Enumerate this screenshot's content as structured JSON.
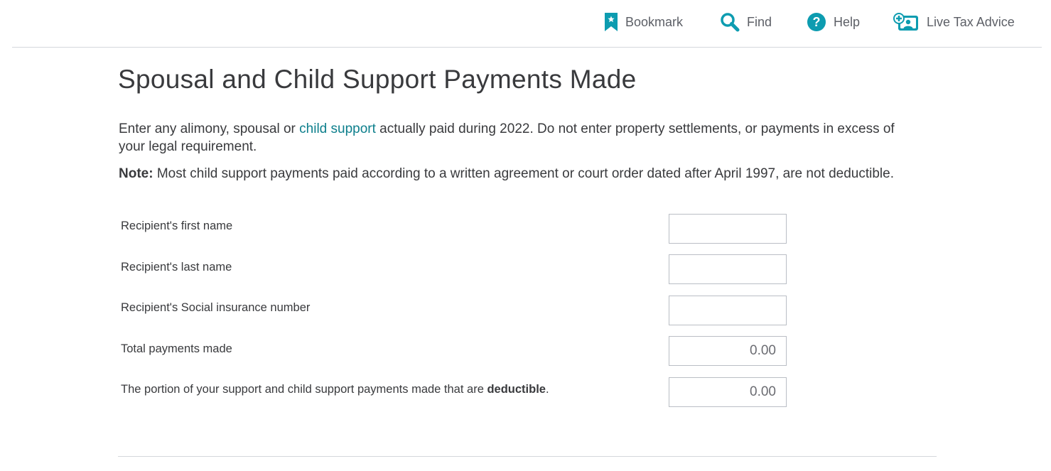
{
  "toolbar": {
    "bookmark_label": "Bookmark",
    "find_label": "Find",
    "help_label": "Help",
    "live_label": "Live Tax Advice"
  },
  "page": {
    "title": "Spousal and Child Support Payments Made",
    "intro_before_link": "Enter any alimony, spousal or ",
    "intro_link": "child support",
    "intro_after_link": " actually paid during 2022. Do not enter property settlements, or payments in excess of your legal requirement.",
    "note_label": "Note:",
    "note_text": " Most child support payments paid according to a written agreement or court order dated after April 1997, are not deductible."
  },
  "form": {
    "first_name_label": "Recipient's first name",
    "first_name_value": "",
    "last_name_label": "Recipient's last name",
    "last_name_value": "",
    "sin_label": "Recipient's Social insurance number",
    "sin_value": "",
    "total_label": "Total payments made",
    "total_value": "0.00",
    "deductible_label_before": "The portion of your support and child support payments made that are ",
    "deductible_label_bold": "deductible",
    "deductible_label_after": ".",
    "deductible_value": "0.00"
  },
  "icons": {
    "bookmark": "bookmark-icon",
    "find": "search-icon",
    "help": "help-icon",
    "live": "live-advice-icon"
  },
  "colors": {
    "accent": "#0d9cb0",
    "link": "#0d7f8c",
    "text": "#393a3d"
  }
}
